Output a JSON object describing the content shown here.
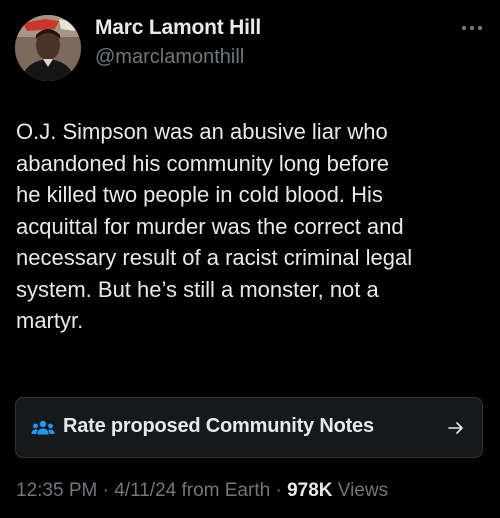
{
  "author": {
    "name": "Marc Lamont Hill",
    "handle": "@marclamonthill"
  },
  "tweet": {
    "text": "O.J. Simpson was an abusive liar who\nabandoned his community long before\nhe killed two people in cold blood. His\nacquittal for murder was the correct and\nnecessary result of a racist criminal legal\nsystem. But he’s still a monster, not a\nmartyr."
  },
  "community_notes": {
    "label": "Rate proposed Community Notes",
    "icon": "people-icon",
    "arrow_icon": "arrow-right-icon"
  },
  "meta": {
    "time": "12:35 PM",
    "separator1": " · ",
    "date": "4/11/24",
    "source": " from Earth",
    "separator2": " · ",
    "views_count": "978K",
    "views_label": " Views"
  },
  "colors": {
    "background": "#000000",
    "primary_text": "#e7e9ea",
    "secondary_text": "#71767b",
    "card_border": "#2f3336",
    "notes_icon": "#1d9bf0"
  },
  "more_icon": "more-dots-icon"
}
